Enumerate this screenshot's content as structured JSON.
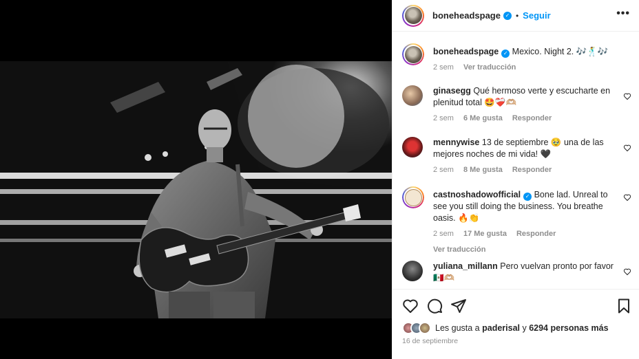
{
  "post": {
    "username": "boneheadspage",
    "follow_label": "Seguir",
    "separator": "•",
    "more_label": "•••"
  },
  "caption": {
    "username": "boneheadspage",
    "text": "Mexico. Night 2. 🎶🕺🎶",
    "time": "2 sem",
    "translate": "Ver traducción"
  },
  "comments": [
    {
      "username": "ginasegg",
      "text": "Qué hermoso verte y escucharte en plenitud total 🤩❤️‍🩹🫶🏼",
      "time": "2 sem",
      "likes": "6 Me gusta",
      "reply": "Responder"
    },
    {
      "username": "mennywise",
      "text": "13 de septiembre 🥹 una de las mejores noches de mi vida! 🖤",
      "time": "2 sem",
      "likes": "8 Me gusta",
      "reply": "Responder"
    },
    {
      "username": "castnoshadowofficial",
      "text": "Bone lad. Unreal to see you still doing the business. You breathe oasis. 🔥👏",
      "time": "2 sem",
      "likes": "17 Me gusta",
      "reply": "Responder",
      "translate": "Ver traducción"
    },
    {
      "username": "yuliana_millann",
      "text": "Pero vuelvan pronto por favor 🇲🇽🫶🏼"
    }
  ],
  "likes": {
    "prefix": "Les gusta a ",
    "user": "paderisal",
    "middle": " y ",
    "others": "6294 personas más"
  },
  "date": "16 de septiembre",
  "icons": [
    "heart-icon",
    "comment-icon",
    "share-icon",
    "bookmark-icon",
    "verified-badge-icon"
  ],
  "colors": {
    "accent": "#0095f6",
    "text": "#262626",
    "muted": "#8e8e8e",
    "verified": "#0095f6"
  }
}
